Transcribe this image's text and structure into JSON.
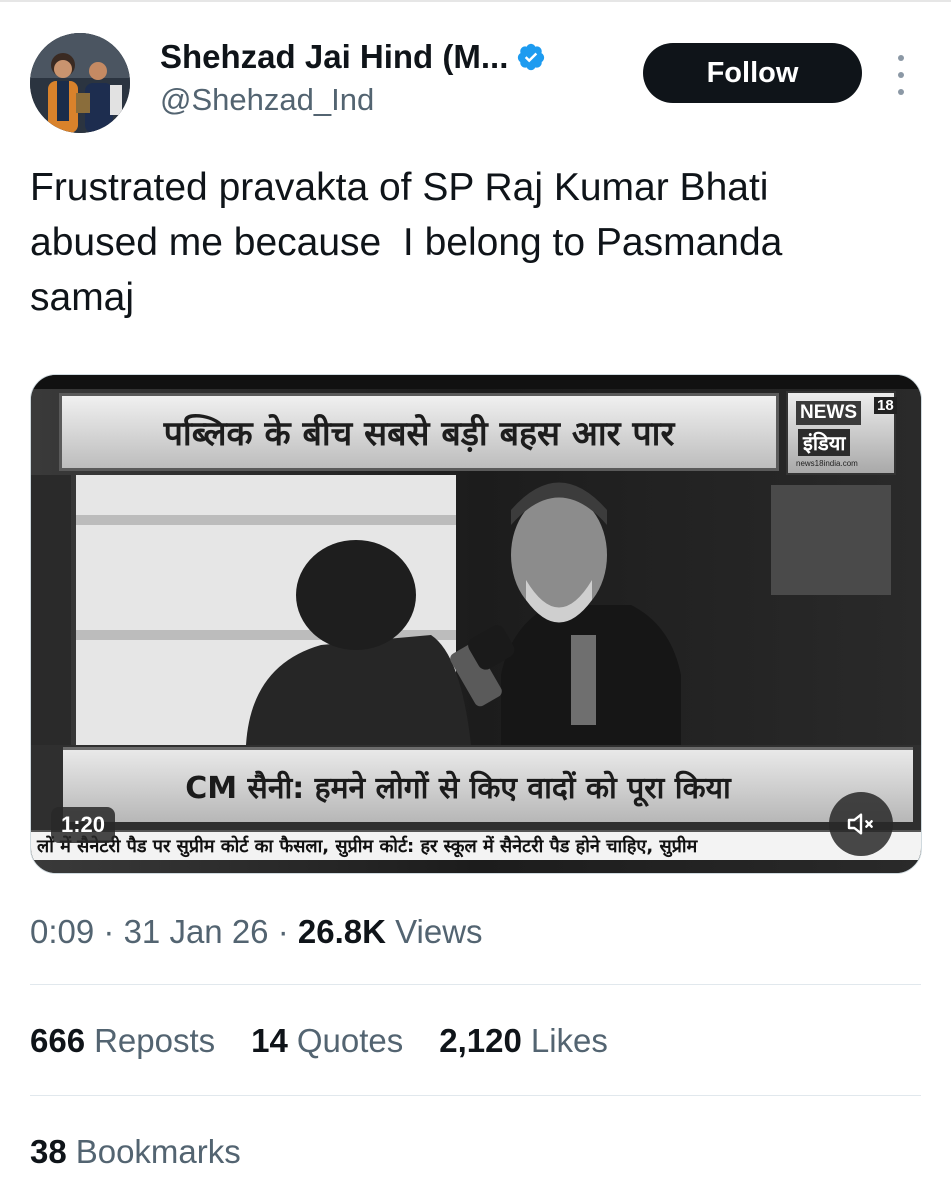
{
  "author": {
    "display_name": "Shehzad Jai Hind (M...",
    "handle": "@Shehzad_Ind",
    "verified": true,
    "avatar_icon": "user-avatar"
  },
  "follow_label": "Follow",
  "more_icon": "more-vertical-icon",
  "tweet": {
    "text": "Frustrated pravakta of SP Raj Kumar Bhati\nabused me because  I belong to Pasmanda\nsamaj"
  },
  "video": {
    "headline": "पब्लिक के बीच सबसे बड़ी बहस आर पार",
    "channel": {
      "news": "NEWS",
      "number": "18",
      "hindi": "इंडिया",
      "url": "news18india.com"
    },
    "lower_third": "CM सैनी: हमने लोगों से किए वादों को पूरा किया",
    "ticker": "लों में सैनेटरी पैड पर सुप्रीम कोर्ट का फैसला, सुप्रीम कोर्ट: हर स्कूल में सैनेटरी पैड होने चाहिए, सुप्रीम",
    "duration": "1:20",
    "mute_icon": "volume-muted-icon"
  },
  "meta": {
    "time": "0:09",
    "separator": "·",
    "date": "31 Jan 26",
    "views_count": "26.8K",
    "views_label": "Views"
  },
  "stats": {
    "reposts": {
      "count": "666",
      "label": "Reposts"
    },
    "quotes": {
      "count": "14",
      "label": "Quotes"
    },
    "likes": {
      "count": "2,120",
      "label": "Likes"
    },
    "bookmarks": {
      "count": "38",
      "label": "Bookmarks"
    }
  },
  "colors": {
    "text_primary": "#0f1419",
    "text_secondary": "#536471",
    "verified_blue": "#1d9bf0",
    "follow_bg": "#0f1419",
    "divider": "#e1e8ed"
  }
}
